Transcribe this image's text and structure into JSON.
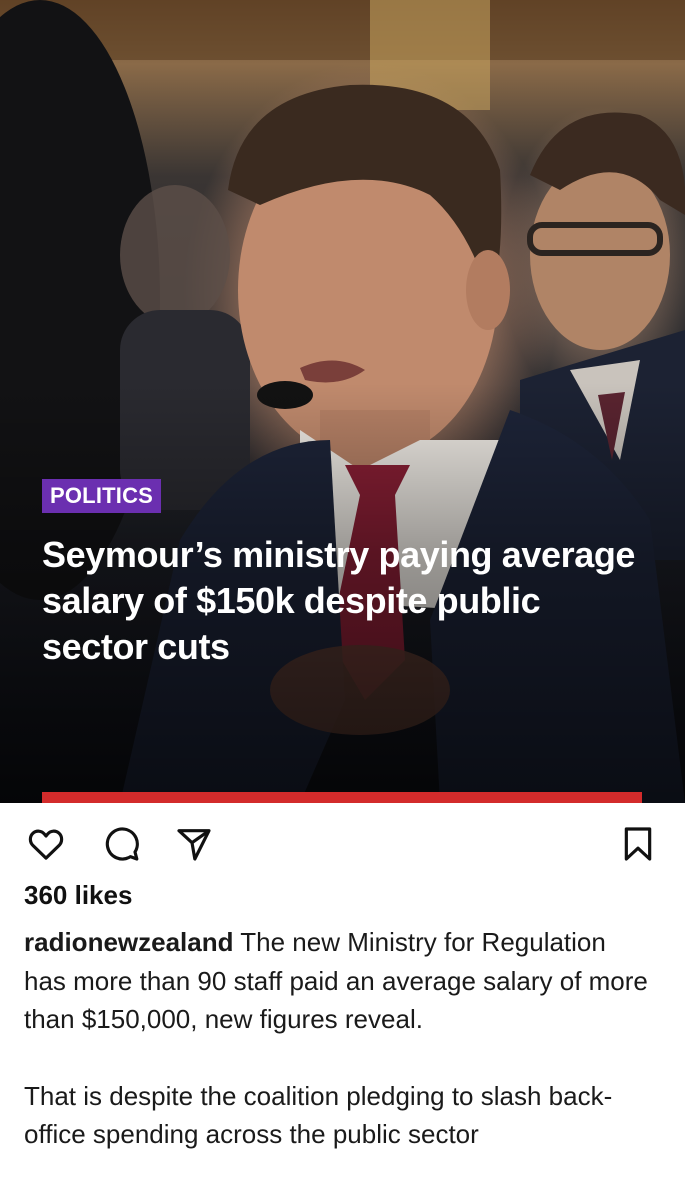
{
  "post": {
    "category": "POLITICS",
    "headline": "Seymour’s ministry paying average salary of $150k despite public sector cuts"
  },
  "actions": {
    "like_icon": "heart-icon",
    "comment_icon": "comment-icon",
    "share_icon": "send-icon",
    "save_icon": "bookmark-icon"
  },
  "likes": "360 likes",
  "caption": {
    "username": "radionewzealand",
    "paragraph1": " The new Ministry for Regulation has more than 90 staff paid an average salary of more than $150,000, new figures reveal.",
    "paragraph2": "That is despite the coalition pledging to slash back-office spending across the public sector"
  },
  "colors": {
    "badge": "#6b2fb0",
    "bar": "#d32b2b"
  }
}
